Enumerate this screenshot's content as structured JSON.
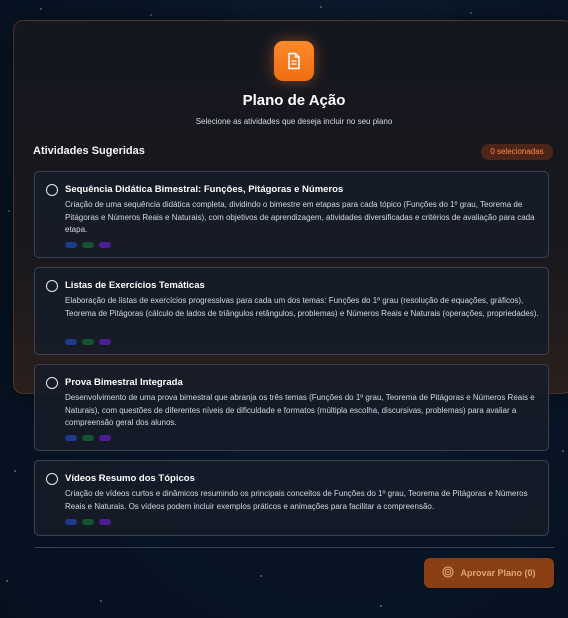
{
  "header": {
    "title": "Plano de Ação",
    "subtitle": "Selecione as atividades que deseja incluir no seu plano",
    "icon": "document-icon"
  },
  "section": {
    "title": "Atividades Sugeridas",
    "selected_badge": "0 selecionadas"
  },
  "activities": [
    {
      "title": "Sequência Didática Bimestral: Funções, Pitágoras e Números",
      "description": "Criação de uma sequência didática completa, dividindo o bimestre em etapas para cada tópico (Funções do 1º grau, Teorema de Pitágoras e Números Reais e Naturais), com objetivos de aprendizagem, atividades diversificadas e critérios de avaliação para cada etapa."
    },
    {
      "title": "Listas de Exercícios Temáticas",
      "description": "Elaboração de listas de exercícios progressivas para cada um dos temas: Funções do 1º grau (resolução de equações, gráficos), Teorema de Pitágoras (cálculo de lados de triângulos retângulos, problemas) e Números Reais e Naturais (operações, propriedades)."
    },
    {
      "title": "Prova Bimestral Integrada",
      "description": "Desenvolvimento de uma prova bimestral que abranja os três temas (Funções do 1º grau, Teorema de Pitágoras e Números Reais e Naturais), com questões de diferentes níveis de dificuldade e formatos (múltipla escolha, discursivas, problemas) para avaliar a compreensão geral dos alunos."
    },
    {
      "title": "Vídeos Resumo dos Tópicos",
      "description": "Criação de vídeos curtos e dinâmicos resumindo os principais conceitos de Funções do 1º grau, Teorema de Pitágoras e Números Reais e Naturais. Os vídeos podem incluir exemplos práticos e animações para facilitar a compreensão."
    }
  ],
  "tag_colors": [
    "#1e3a8a",
    "#14532d",
    "#4c1d95"
  ],
  "footer": {
    "approve_label": "Aprovar Plano (0)",
    "approve_icon": "target-icon"
  },
  "colors": {
    "accent": "#f97316",
    "background": "#081526"
  }
}
